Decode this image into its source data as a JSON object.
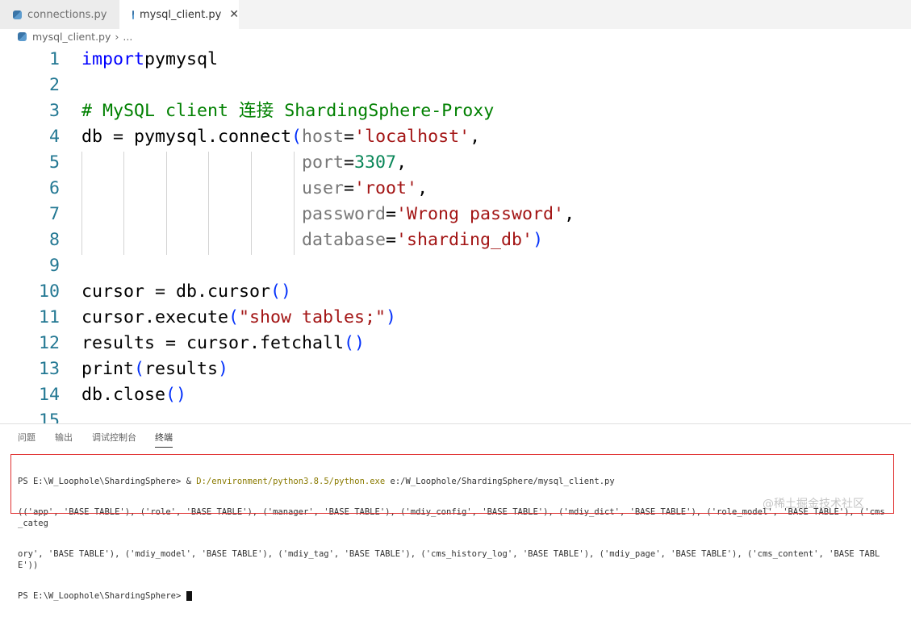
{
  "tabs": [
    {
      "label": "connections.py",
      "active": false
    },
    {
      "label": "mysql_client.py",
      "active": true
    }
  ],
  "breadcrumb": {
    "file": "mysql_client.py",
    "sep": "›",
    "rest": "..."
  },
  "code": [
    {
      "n": "1",
      "t": [
        [
          "k",
          "import"
        ],
        [
          "",
          "pymysql"
        ]
      ]
    },
    {
      "n": "2",
      "t": []
    },
    {
      "n": "3",
      "t": [
        [
          "c",
          "# MySQL client 连接 ShardingSphere-Proxy"
        ]
      ]
    },
    {
      "n": "4",
      "t": [
        [
          "",
          "db = pymysql.connect"
        ],
        [
          "p",
          "("
        ],
        [
          "a",
          "host"
        ],
        [
          "",
          "="
        ],
        [
          "s",
          "'localhost'"
        ],
        [
          "",
          ","
        ]
      ]
    },
    {
      "n": "5",
      "t": [
        [
          "",
          "                     "
        ],
        [
          "a",
          "port"
        ],
        [
          "",
          "="
        ],
        [
          "n",
          "3307"
        ],
        [
          "",
          ","
        ]
      ]
    },
    {
      "n": "6",
      "t": [
        [
          "",
          "                     "
        ],
        [
          "a",
          "user"
        ],
        [
          "",
          "="
        ],
        [
          "s",
          "'root'"
        ],
        [
          "",
          ","
        ]
      ]
    },
    {
      "n": "7",
      "t": [
        [
          "",
          "                     "
        ],
        [
          "a",
          "password"
        ],
        [
          "",
          "="
        ],
        [
          "s",
          "'Wrong password'"
        ],
        [
          "",
          ","
        ]
      ]
    },
    {
      "n": "8",
      "t": [
        [
          "",
          "                     "
        ],
        [
          "a",
          "database"
        ],
        [
          "",
          "="
        ],
        [
          "s",
          "'sharding_db'"
        ],
        [
          "p",
          ")"
        ]
      ]
    },
    {
      "n": "9",
      "t": []
    },
    {
      "n": "10",
      "t": [
        [
          "",
          "cursor = db.cursor"
        ],
        [
          "p",
          "()"
        ]
      ]
    },
    {
      "n": "11",
      "t": [
        [
          "",
          "cursor.execute"
        ],
        [
          "p",
          "("
        ],
        [
          "s",
          "\"show tables;\""
        ],
        [
          "p",
          ")"
        ]
      ]
    },
    {
      "n": "12",
      "t": [
        [
          "",
          "results = cursor.fetchall"
        ],
        [
          "p",
          "()"
        ]
      ]
    },
    {
      "n": "13",
      "t": [
        [
          "",
          "print"
        ],
        [
          "p",
          "("
        ],
        [
          "",
          "results"
        ],
        [
          "p",
          ")"
        ]
      ]
    },
    {
      "n": "14",
      "t": [
        [
          "",
          "db.close"
        ],
        [
          "p",
          "()"
        ]
      ]
    },
    {
      "n": "15",
      "t": []
    }
  ],
  "panel": {
    "tabs": [
      "问题",
      "输出",
      "调试控制台",
      "终端"
    ],
    "active": 3
  },
  "terminal": {
    "prompt": "PS E:\\W_Loophole\\ShardingSphere> ",
    "cmd_amp": "& ",
    "cmd_exe": "D:/environment/python3.8.5/python.exe",
    "cmd_arg": " e:/W_Loophole/ShardingSphere/mysql_client.py",
    "out1": "(('app', 'BASE TABLE'), ('role', 'BASE TABLE'), ('manager', 'BASE TABLE'), ('mdiy_config', 'BASE TABLE'), ('mdiy_dict', 'BASE TABLE'), ('role_model', 'BASE TABLE'), ('cms_categ",
    "out2": "ory', 'BASE TABLE'), ('mdiy_model', 'BASE TABLE'), ('mdiy_tag', 'BASE TABLE'), ('cms_history_log', 'BASE TABLE'), ('mdiy_page', 'BASE TABLE'), ('cms_content', 'BASE TABLE'))",
    "prompt2": "PS E:\\W_Loophole\\ShardingSphere> "
  },
  "watermark": "@稀土掘金技术社区"
}
